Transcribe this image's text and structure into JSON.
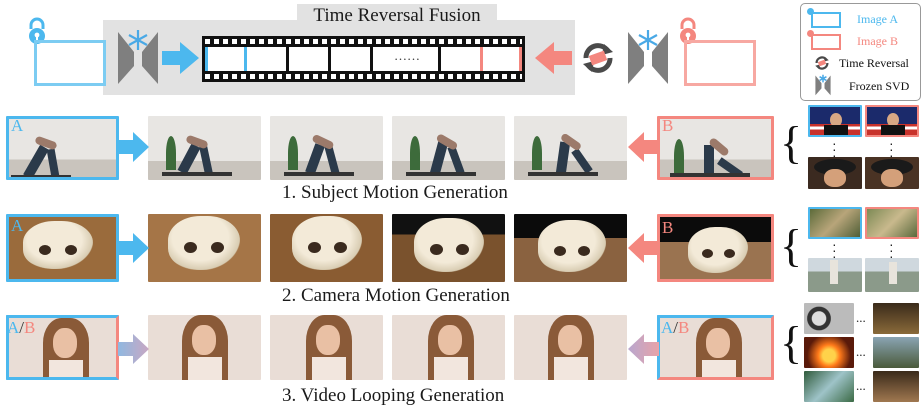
{
  "banner": {
    "title": "Time Reversal Fusion",
    "filmstrip_dots": "……"
  },
  "legend": {
    "image_a": "Image A",
    "image_b": "Image B",
    "time_reversal": "Time Reversal",
    "frozen_svd": "Frozen SVD"
  },
  "rows": [
    {
      "caption": "1. Subject Motion Generation",
      "tag_left": "A",
      "tag_right": "B"
    },
    {
      "caption": "2. Camera Motion Generation",
      "tag_left": "A",
      "tag_right": "B"
    },
    {
      "caption": "3. Video Looping Generation",
      "tag_left_a": "A",
      "tag_slash": "/",
      "tag_left_b": "B",
      "tag_right_a": "A",
      "tag_right_slash": "/",
      "tag_right_b": "B"
    }
  ],
  "colors": {
    "image_a": "#4cb8ee",
    "image_b": "#f4877f",
    "banner_bg": "#e2e2e2",
    "snow": "#4aa9e6"
  },
  "side": {
    "ellipsis": "..."
  }
}
